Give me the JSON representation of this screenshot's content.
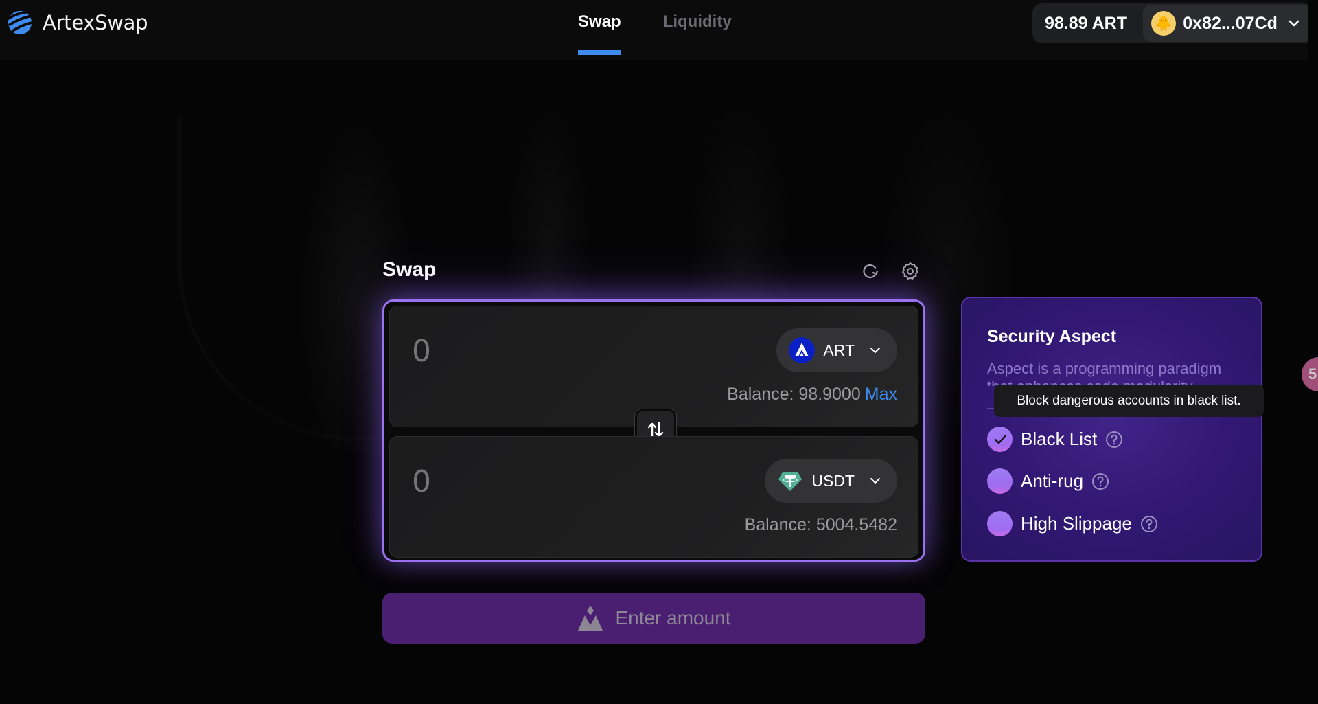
{
  "header": {
    "app_name": "ArtexSwap",
    "nav_tabs": [
      {
        "label": "Swap",
        "active": true
      },
      {
        "label": "Liquidity",
        "active": false
      }
    ],
    "wallet": {
      "balance": "98.89 ART",
      "avatar_icon": "chick-avatar",
      "address": "0x82...07Cd"
    }
  },
  "swap": {
    "title": "Swap",
    "refresh_icon": "refresh-icon",
    "settings_icon": "gear-icon",
    "from": {
      "amount_placeholder": "0",
      "token": "ART",
      "token_color": "#0a1fc4",
      "balance_label": "Balance: 98.9000",
      "max_label": "Max"
    },
    "to": {
      "amount_placeholder": "0",
      "token": "USDT",
      "token_color": "#50af95",
      "balance_label": "Balance: 5004.5482"
    },
    "switch_icon": "swap-arrows-icon",
    "submit_label": "Enter amount"
  },
  "security": {
    "title": "Security Aspect",
    "description": "Aspect is a programming paradigm that enhances code modularity",
    "tooltip": "Block dangerous accounts in black list.",
    "options": [
      {
        "label": "Black List",
        "checked": true
      },
      {
        "label": "Anti-rug",
        "checked": false
      },
      {
        "label": "High Slippage",
        "checked": false
      }
    ]
  },
  "colors": {
    "accent_blue": "#3f8cf0",
    "accent_purple": "#9a72f0",
    "button_purple": "#4a1f72"
  },
  "edge_badge_text": "5"
}
